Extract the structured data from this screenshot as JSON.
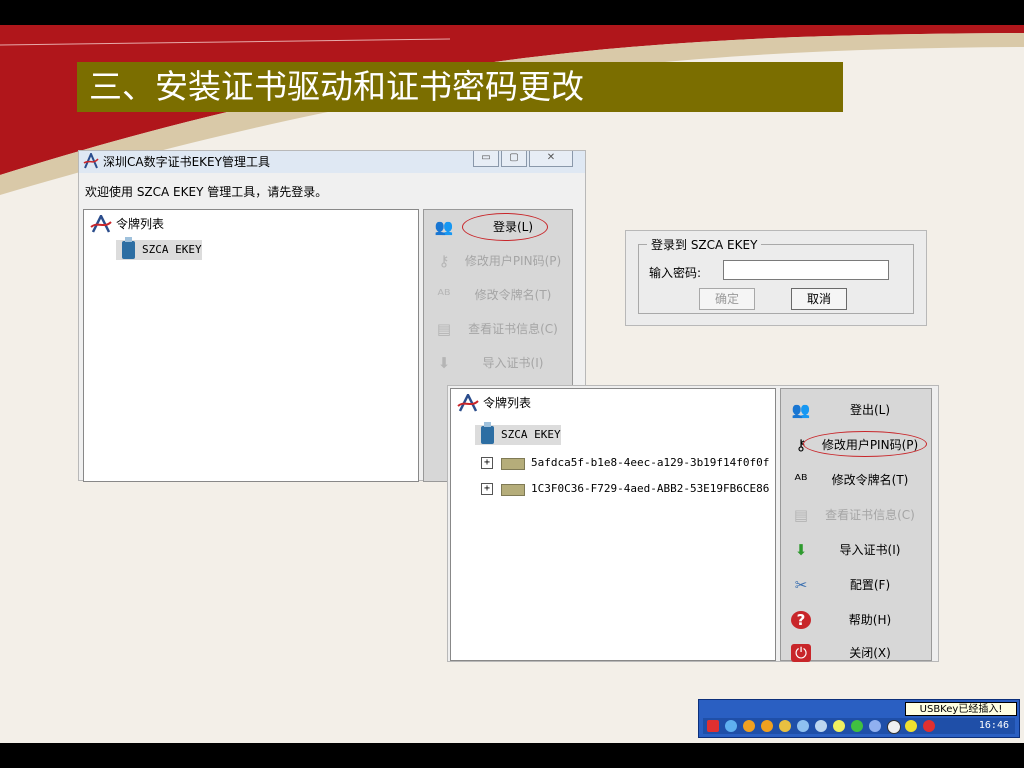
{
  "slide": {
    "title": "三、安装证书驱动和证书密码更改",
    "colors": {
      "title_bg": "#7b6e00",
      "accent_red": "#b0161b"
    }
  },
  "login_window": {
    "title": "深圳CA数字证书EKEY管理工具",
    "controls": [
      "minimize",
      "maximize",
      "close"
    ],
    "welcome": "欢迎使用 SZCA EKEY 管理工具，请先登录。",
    "tree": {
      "root": "令牌列表",
      "token": "SZCA EKEY"
    },
    "actions": [
      {
        "label": "登录(L)",
        "icon": "users-icon",
        "enabled": true
      },
      {
        "label": "修改用户PIN码(P)",
        "icon": "key-icon",
        "enabled": false
      },
      {
        "label": "修改令牌名(T)",
        "icon": "rename-icon",
        "enabled": false
      },
      {
        "label": "查看证书信息(C)",
        "icon": "certificate-icon",
        "enabled": false
      },
      {
        "label": "导入证书(I)",
        "icon": "import-icon",
        "enabled": false
      }
    ]
  },
  "pin_dialog": {
    "group_label": "登录到 SZCA EKEY",
    "password_label": "输入密码:",
    "password_value": "",
    "confirm_button": "确定",
    "cancel_button": "取消"
  },
  "manager_window": {
    "tree": {
      "root": "令牌列表",
      "token": "SZCA EKEY",
      "certificates": [
        "5afdca5f-b1e8-4eec-a129-3b19f14f0f0f",
        "1C3F0C36-F729-4aed-ABB2-53E19FB6CE86"
      ]
    },
    "actions": [
      {
        "label": "登出(L)",
        "icon": "users-icon",
        "enabled": true
      },
      {
        "label": "修改用户PIN码(P)",
        "icon": "key-icon",
        "enabled": true
      },
      {
        "label": "修改令牌名(T)",
        "icon": "rename-icon",
        "enabled": true
      },
      {
        "label": "查看证书信息(C)",
        "icon": "certificate-icon",
        "enabled": false
      },
      {
        "label": "导入证书(I)",
        "icon": "import-icon",
        "enabled": true
      },
      {
        "label": "配置(F)",
        "icon": "config-icon",
        "enabled": true
      },
      {
        "label": "帮助(H)",
        "icon": "help-icon",
        "enabled": true
      },
      {
        "label": "关闭(X)",
        "icon": "power-icon",
        "enabled": true
      }
    ]
  },
  "taskbar": {
    "tooltip": "USBKey已经插入!",
    "clock": "16:46"
  }
}
